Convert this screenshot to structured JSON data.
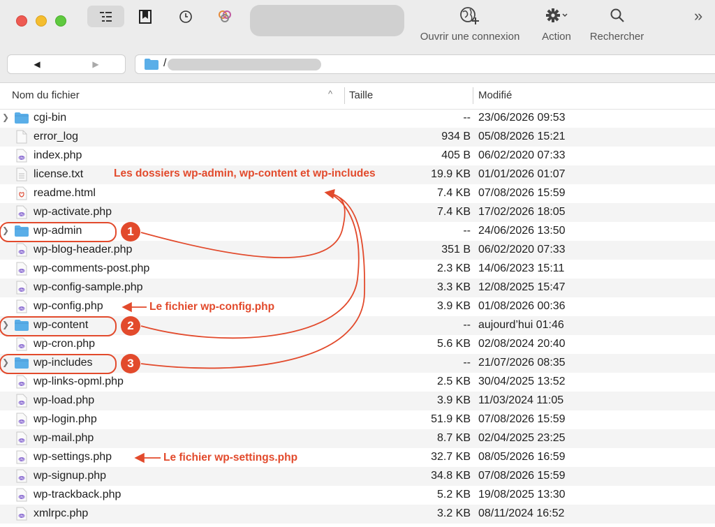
{
  "toolbar": {
    "connect_label": "Ouvrir une connexion",
    "action_label": "Action",
    "search_label": "Rechercher"
  },
  "path": {
    "root": "/"
  },
  "columns": {
    "name": "Nom du fichier",
    "size": "Taille",
    "modified": "Modifié"
  },
  "files": [
    {
      "name": "cgi-bin",
      "size": "--",
      "modified": "23/06/2026 09:53",
      "type": "folder"
    },
    {
      "name": "error_log",
      "size": "934 B",
      "modified": "05/08/2026 15:21",
      "type": "file"
    },
    {
      "name": "index.php",
      "size": "405 B",
      "modified": "06/02/2020 07:33",
      "type": "php"
    },
    {
      "name": "license.txt",
      "size": "19.9 KB",
      "modified": "01/01/2026 01:07",
      "type": "text"
    },
    {
      "name": "readme.html",
      "size": "7.4 KB",
      "modified": "07/08/2026 15:59",
      "type": "html"
    },
    {
      "name": "wp-activate.php",
      "size": "7.4 KB",
      "modified": "17/02/2026 18:05",
      "type": "php"
    },
    {
      "name": "wp-admin",
      "size": "--",
      "modified": "24/06/2026 13:50",
      "type": "folder"
    },
    {
      "name": "wp-blog-header.php",
      "size": "351 B",
      "modified": "06/02/2020 07:33",
      "type": "php"
    },
    {
      "name": "wp-comments-post.php",
      "size": "2.3 KB",
      "modified": "14/06/2023 15:11",
      "type": "php"
    },
    {
      "name": "wp-config-sample.php",
      "size": "3.3 KB",
      "modified": "12/08/2025 15:47",
      "type": "php"
    },
    {
      "name": "wp-config.php",
      "size": "3.9 KB",
      "modified": "01/08/2026 00:36",
      "type": "php"
    },
    {
      "name": "wp-content",
      "size": "--",
      "modified": "aujourd’hui 01:46",
      "type": "folder"
    },
    {
      "name": "wp-cron.php",
      "size": "5.6 KB",
      "modified": "02/08/2024 20:40",
      "type": "php"
    },
    {
      "name": "wp-includes",
      "size": "--",
      "modified": "21/07/2026 08:35",
      "type": "folder"
    },
    {
      "name": "wp-links-opml.php",
      "size": "2.5 KB",
      "modified": "30/04/2025 13:52",
      "type": "php"
    },
    {
      "name": "wp-load.php",
      "size": "3.9 KB",
      "modified": "11/03/2024 11:05",
      "type": "php"
    },
    {
      "name": "wp-login.php",
      "size": "51.9 KB",
      "modified": "07/08/2026 15:59",
      "type": "php"
    },
    {
      "name": "wp-mail.php",
      "size": "8.7 KB",
      "modified": "02/04/2025 23:25",
      "type": "php"
    },
    {
      "name": "wp-settings.php",
      "size": "32.7 KB",
      "modified": "08/05/2026 16:59",
      "type": "php"
    },
    {
      "name": "wp-signup.php",
      "size": "34.8 KB",
      "modified": "07/08/2026 15:59",
      "type": "php"
    },
    {
      "name": "wp-trackback.php",
      "size": "5.2 KB",
      "modified": "19/08/2025 13:30",
      "type": "php"
    },
    {
      "name": "xmlrpc.php",
      "size": "3.2 KB",
      "modified": "08/11/2024 16:52",
      "type": "php"
    }
  ],
  "annotations": {
    "folders_note": "Les dossiers wp-admin, wp-content et wp-includes",
    "config_note": "Le fichier wp-config.php",
    "settings_note": "Le fichier wp-settings.php",
    "badge_1": "1",
    "badge_2": "2",
    "badge_3": "3",
    "color": "#e24a2c"
  },
  "colors": {
    "folder_blue": "#5aaee8",
    "php_purple": "#8a6bd1",
    "row_alt": "#f4f4f4"
  }
}
